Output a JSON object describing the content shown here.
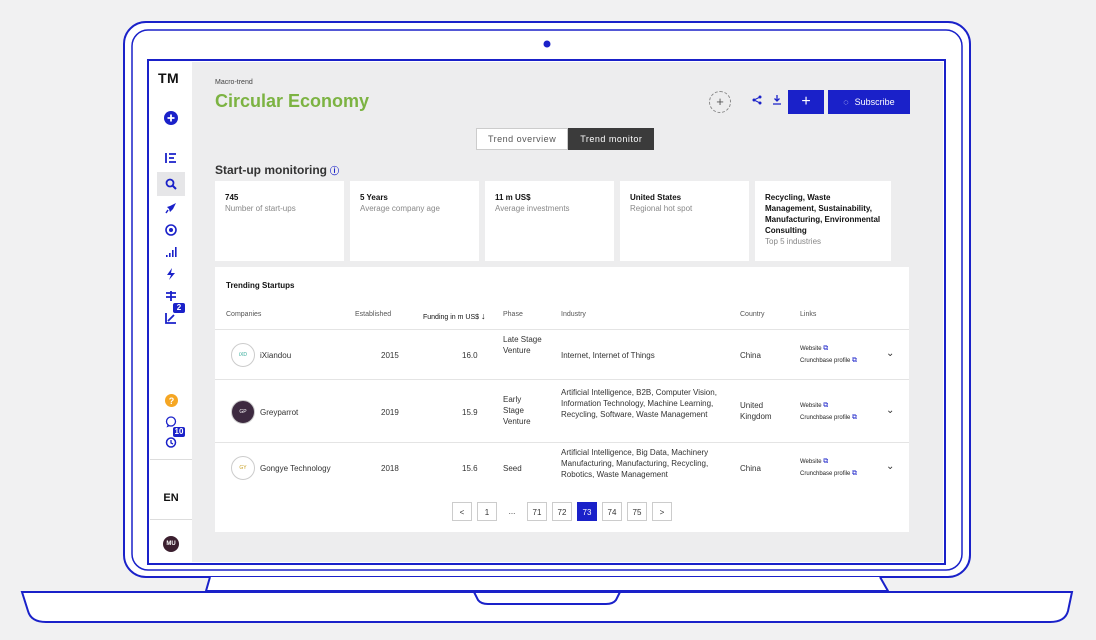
{
  "sidebar": {
    "logo": "TM",
    "language": "EN",
    "avatar": "MU",
    "badges": {
      "favorites": "2",
      "history": "10"
    },
    "icons": [
      "add-circle-icon",
      "trends-icon",
      "search-icon",
      "rocket-icon",
      "radar-icon",
      "signal-bars-icon",
      "bolt-icon",
      "filter-icon",
      "favorites-icon",
      "help-icon",
      "chat-icon",
      "history-icon"
    ]
  },
  "header": {
    "eyebrow": "Macro-trend",
    "title": "Circular Economy",
    "add_circle": "+",
    "plus_label": "+",
    "subscribe_label": "Subscribe"
  },
  "tabs": [
    {
      "label": "Trend overview",
      "active": false
    },
    {
      "label": "Trend monitor",
      "active": true
    }
  ],
  "section": {
    "title": "Start-up monitoring"
  },
  "kpis": [
    {
      "value": "745",
      "label": "Number of start-ups"
    },
    {
      "value": "5 Years",
      "label": "Average company age"
    },
    {
      "value": "11 m US$",
      "label": "Average investments"
    },
    {
      "value": "United States",
      "label": "Regional hot spot"
    },
    {
      "value": "Recycling, Waste Management, Sustainability, Manufacturing, Environmental Consulting",
      "label": "Top 5 industries"
    }
  ],
  "table": {
    "title": "Trending Startups",
    "columns": [
      "Companies",
      "Established",
      "Funding in m US$",
      "Phase",
      "Industry",
      "Country",
      "Links"
    ],
    "rows": [
      {
        "company": "iXiandou",
        "logo_text": "iXD",
        "established": "2015",
        "funding": "16.0",
        "phase": "Late Stage Venture",
        "industry": "Internet, Internet of Things",
        "country": "China",
        "website": "Website",
        "crunchbase": "Crunchbase profile"
      },
      {
        "company": "Greyparrot",
        "logo_text": "GP",
        "established": "2019",
        "funding": "15.9",
        "phase": "Early Stage Venture",
        "industry": "Artificial Intelligence, B2B, Computer Vision, Information Technology, Machine Learning, Recycling, Software, Waste Management",
        "country": "United Kingdom",
        "website": "Website",
        "crunchbase": "Crunchbase profile"
      },
      {
        "company": "Gongye Technology",
        "logo_text": "GY",
        "established": "2018",
        "funding": "15.6",
        "phase": "Seed",
        "industry": "Artificial Intelligence, Big Data, Machinery Manufacturing, Manufacturing, Recycling, Robotics, Waste Management",
        "country": "China",
        "website": "Website",
        "crunchbase": "Crunchbase profile"
      }
    ]
  },
  "pagination": {
    "prev": "<",
    "next": ">",
    "first": "1",
    "ellipsis": "...",
    "pages": [
      "71",
      "72",
      "73",
      "74",
      "75"
    ],
    "current": "73"
  },
  "colors": {
    "accent": "#1a21c9",
    "title_green": "#7cb342"
  }
}
